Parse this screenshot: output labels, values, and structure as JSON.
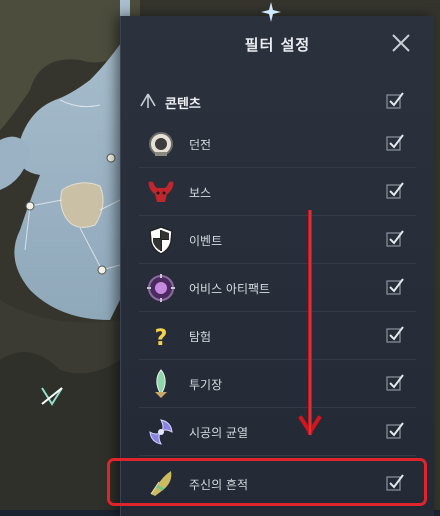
{
  "panel": {
    "title": "필터 설정"
  },
  "category": {
    "label": "콘텐츠",
    "checked": true
  },
  "items": [
    {
      "label": "던전",
      "icon": "dungeon-icon",
      "checked": true
    },
    {
      "label": "보스",
      "icon": "boss-icon",
      "checked": true
    },
    {
      "label": "이벤트",
      "icon": "event-icon",
      "checked": true
    },
    {
      "label": "어비스 아티팩트",
      "icon": "abyss-artifact-icon",
      "checked": true
    },
    {
      "label": "탐험",
      "icon": "exploration-icon",
      "checked": true
    },
    {
      "label": "투기장",
      "icon": "arena-icon",
      "checked": true
    },
    {
      "label": "시공의 균열",
      "icon": "rift-icon",
      "checked": true
    },
    {
      "label": "주신의 흔적",
      "icon": "god-trace-icon",
      "checked": true
    }
  ],
  "colors": {
    "highlight": "#e0242b",
    "panel": "#2b313d",
    "checkmark": "#d9dde3"
  }
}
